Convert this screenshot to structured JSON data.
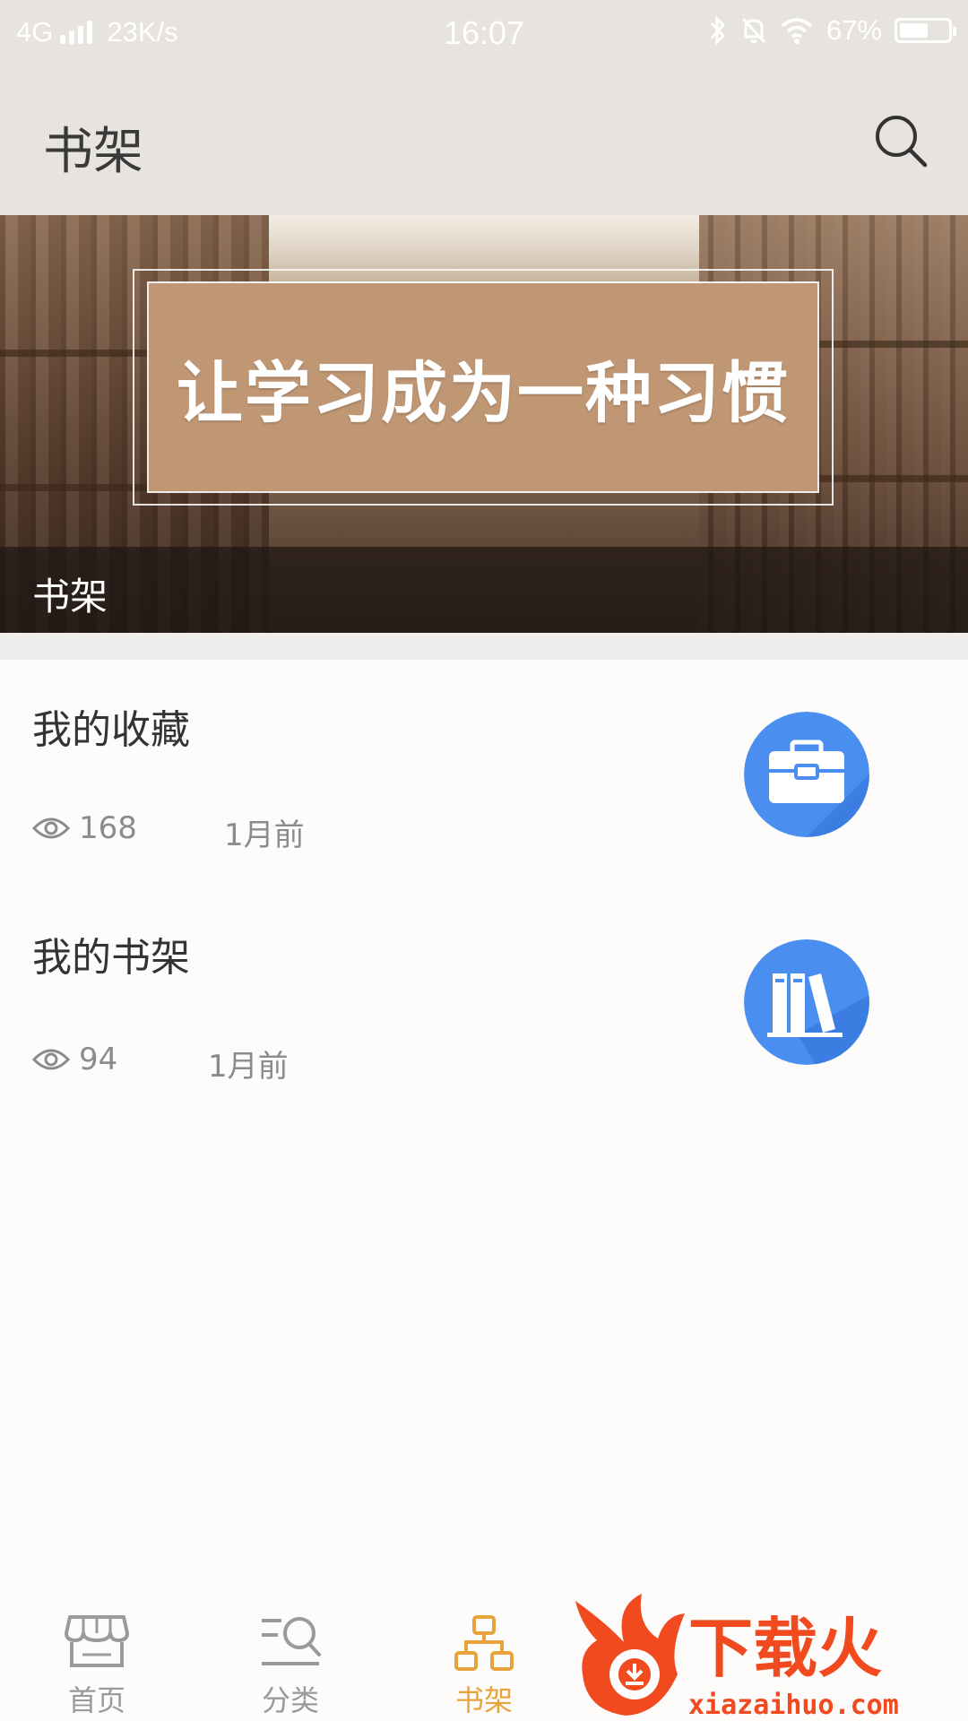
{
  "status_bar": {
    "network": "4G",
    "speed": "23K/s",
    "time": "16:07",
    "battery_percent": "67%",
    "battery_level": 0.67,
    "icons": [
      "signal-icon",
      "bluetooth-icon",
      "mute-icon",
      "wifi-icon",
      "battery-icon"
    ]
  },
  "app_bar": {
    "title": "书架",
    "search_icon": "search-icon"
  },
  "banner": {
    "slogan": "让学习成为一种习惯",
    "caption": "书架"
  },
  "list": [
    {
      "title": "我的收藏",
      "views": "168",
      "time": "1月前",
      "icon": "briefcase-icon"
    },
    {
      "title": "我的书架",
      "views": "94",
      "time": "1月前",
      "icon": "books-icon"
    }
  ],
  "bottom_nav": {
    "items": [
      {
        "label": "首页",
        "icon": "store-icon",
        "active": false
      },
      {
        "label": "分类",
        "icon": "category-search-icon",
        "active": false
      },
      {
        "label": "书架",
        "icon": "org-chart-icon",
        "active": true
      }
    ],
    "active_color": "#e8a33d",
    "inactive_color": "#9a9a9a"
  },
  "watermark": {
    "brand": "下载火",
    "url": "xiazaihuo.com"
  },
  "colors": {
    "accent": "#e8a33d",
    "icon_blue": "#4a8ef0",
    "banner_card": "#c09774"
  }
}
